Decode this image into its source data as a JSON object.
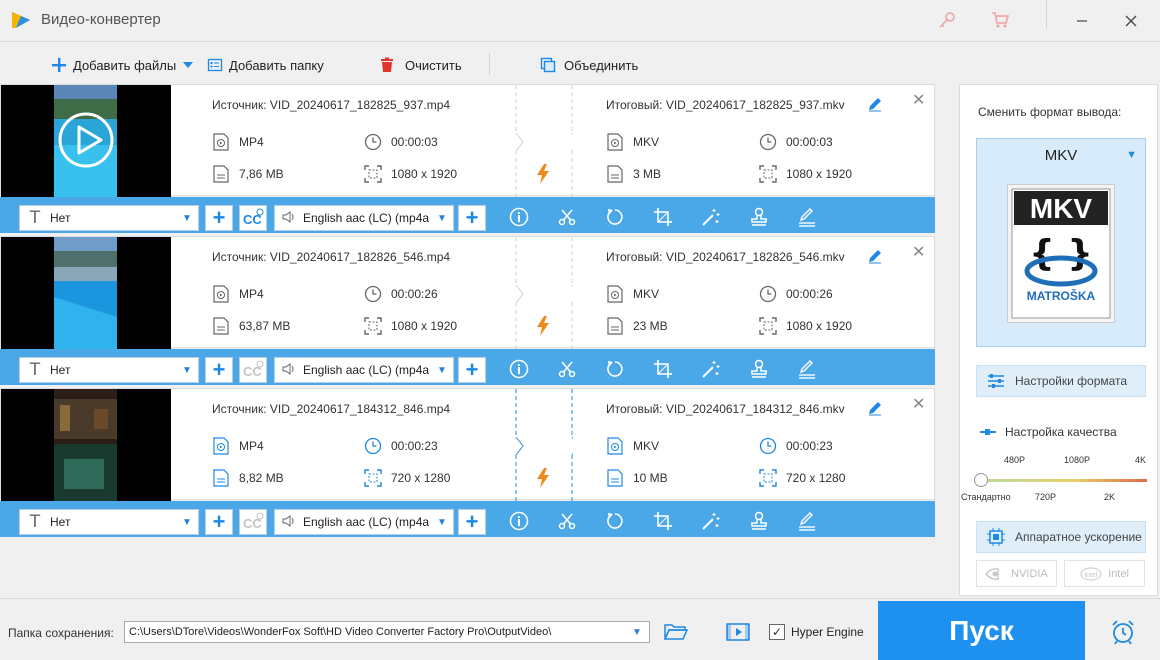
{
  "window": {
    "title": "Видео-конвертер"
  },
  "toolbar": {
    "add_files": "Добавить файлы",
    "add_folder": "Добавить папку",
    "clear": "Очистить",
    "merge": "Объединить"
  },
  "files": [
    {
      "source": "Источник: VID_20240617_182825_937.mp4",
      "output": "Итоговый: VID_20240617_182825_937.mkv",
      "src_format": "MP4",
      "src_duration": "00:00:03",
      "src_size": "7,86 MB",
      "src_resolution": "1080 x 1920",
      "dst_format": "MKV",
      "dst_duration": "00:00:03",
      "dst_size": "3 MB",
      "dst_resolution": "1080 x 1920",
      "subtitle": "Нет",
      "audio": "English aac (LC) (mp4a",
      "subtitle_cc_active": true
    },
    {
      "source": "Источник: VID_20240617_182826_546.mp4",
      "output": "Итоговый: VID_20240617_182826_546.mkv",
      "src_format": "MP4",
      "src_duration": "00:00:26",
      "src_size": "63,87 MB",
      "src_resolution": "1080 x 1920",
      "dst_format": "MKV",
      "dst_duration": "00:00:26",
      "dst_size": "23 MB",
      "dst_resolution": "1080 x 1920",
      "subtitle": "Нет",
      "audio": "English aac (LC) (mp4a",
      "subtitle_cc_active": false
    },
    {
      "source": "Источник: VID_20240617_184312_846.mp4",
      "output": "Итоговый: VID_20240617_184312_846.mkv",
      "src_format": "MP4",
      "src_duration": "00:00:23",
      "src_size": "8,82 MB",
      "src_resolution": "720 x 1280",
      "dst_format": "MKV",
      "dst_duration": "00:00:23",
      "dst_size": "10 MB",
      "dst_resolution": "720 x 1280",
      "subtitle": "Нет",
      "audio": "English aac (LC) (mp4a",
      "subtitle_cc_active": false
    }
  ],
  "right_panel": {
    "title": "Сменить формат вывода:",
    "format": "MKV",
    "card_title": "MKV",
    "card_brand": "MATROŠKA",
    "format_settings": "Настройки формата",
    "quality_label": "Настройка качества",
    "quality_ticks_top": [
      "480P",
      "1080P",
      "4K"
    ],
    "quality_ticks_bottom": [
      "Стандартно",
      "720P",
      "2K"
    ],
    "quality_level": 0,
    "hw_accel": "Аппаратное ускорение",
    "nvidia": "NVIDIA",
    "intel": "Intel"
  },
  "bottom": {
    "save_label": "Папка сохранения:",
    "path": "C:\\Users\\DTore\\Videos\\WonderFox Soft\\HD Video Converter Factory Pro\\OutputVideo\\",
    "hyper_engine": "Hyper Engine",
    "hyper_checked": true,
    "start": "Пуск"
  },
  "colors": {
    "accent": "#1e90f0",
    "bar": "#4aa8e8",
    "lightning": "#f08a1c",
    "delete": "#e0342c"
  }
}
